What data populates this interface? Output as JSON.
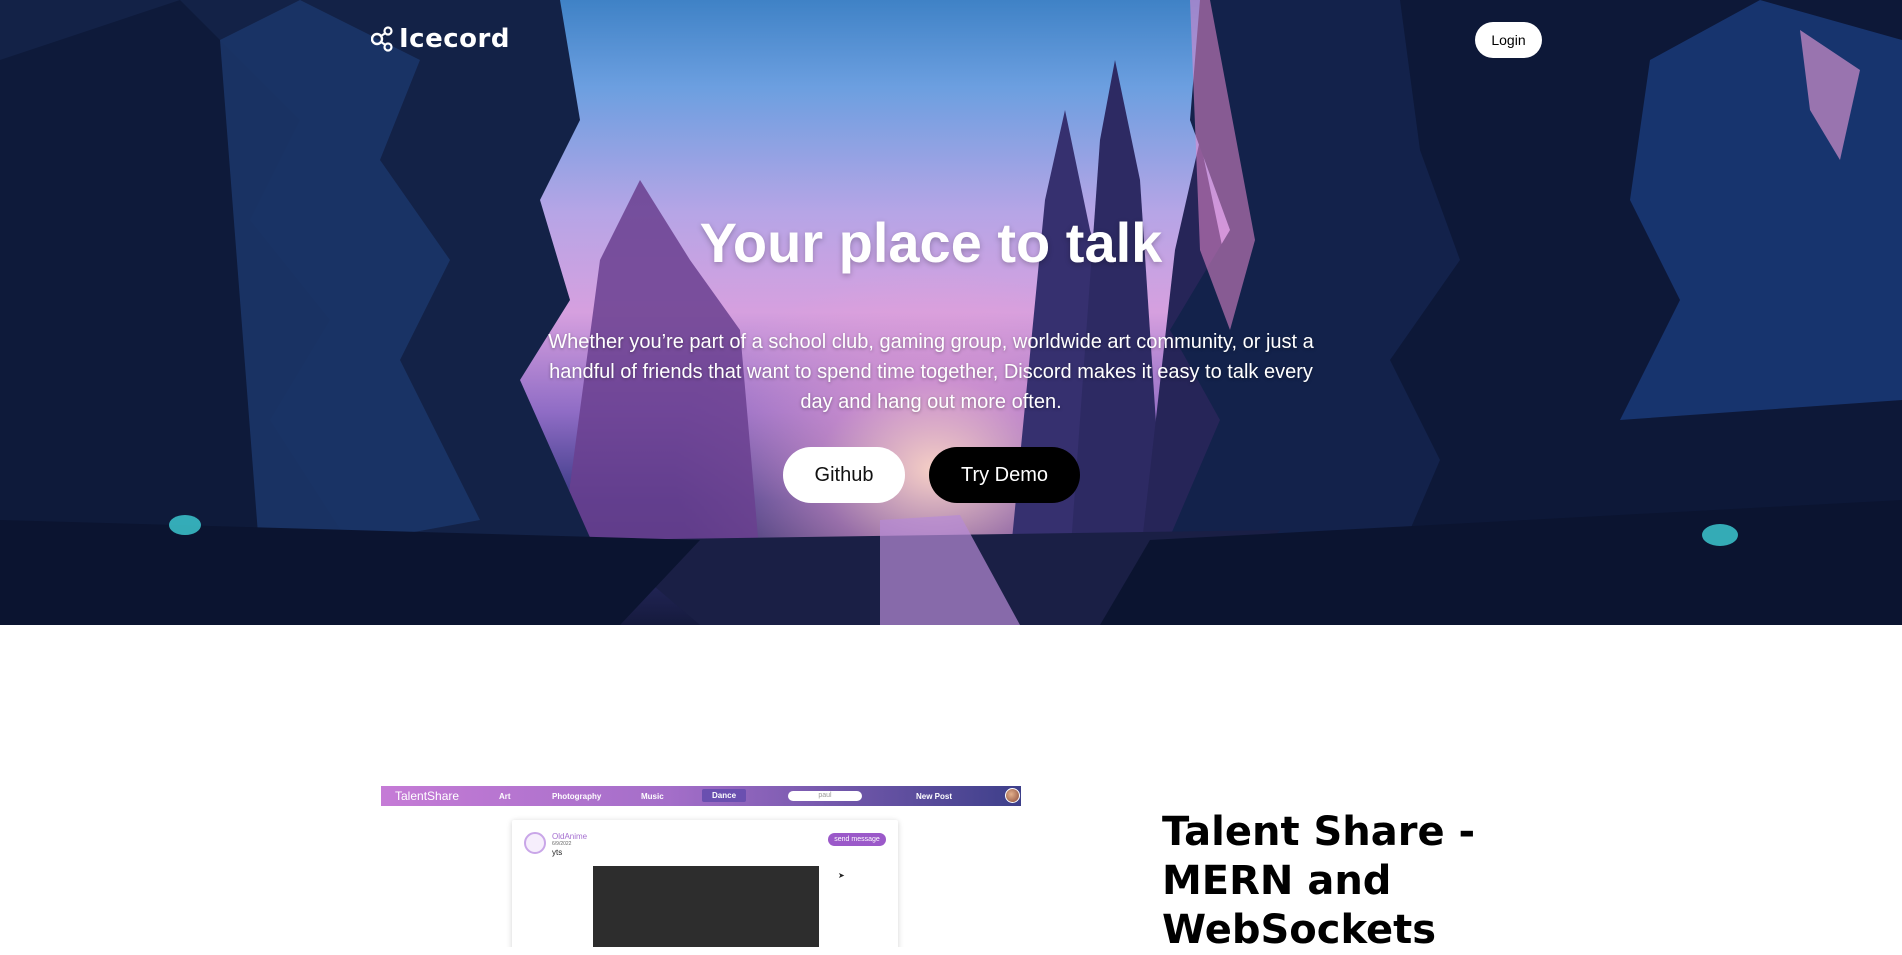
{
  "colors": {
    "primary_button_bg": "#000000",
    "secondary_button_bg": "#ffffff",
    "preview_nav_start": "#c57bd6",
    "preview_nav_end": "#3d3f8a",
    "preview_accent": "#9b59c9"
  },
  "header": {
    "logo_icon": "nodes-icon",
    "logo_text": "Icecord",
    "login_label": "Login"
  },
  "hero": {
    "title": "Your place to talk",
    "description": "Whether you’re part of a school club, gaming group, worldwide art community, or just a handful of friends that want to spend time together, Discord makes it easy to talk every day and hang out more often.",
    "github_label": "Github",
    "demo_label": "Try Demo"
  },
  "project": {
    "title": "Talent Share - MERN and WebSockets",
    "preview": {
      "brand": "TalentShare",
      "nav_links": [
        "Art",
        "Photography",
        "Music",
        "Dance"
      ],
      "active_link": "Dance",
      "search_value": "paul",
      "new_post_label": "New Post",
      "post": {
        "user_name": "OldAnime",
        "date": "6/9/2022",
        "text": "yts",
        "send_label": "send message"
      }
    }
  }
}
